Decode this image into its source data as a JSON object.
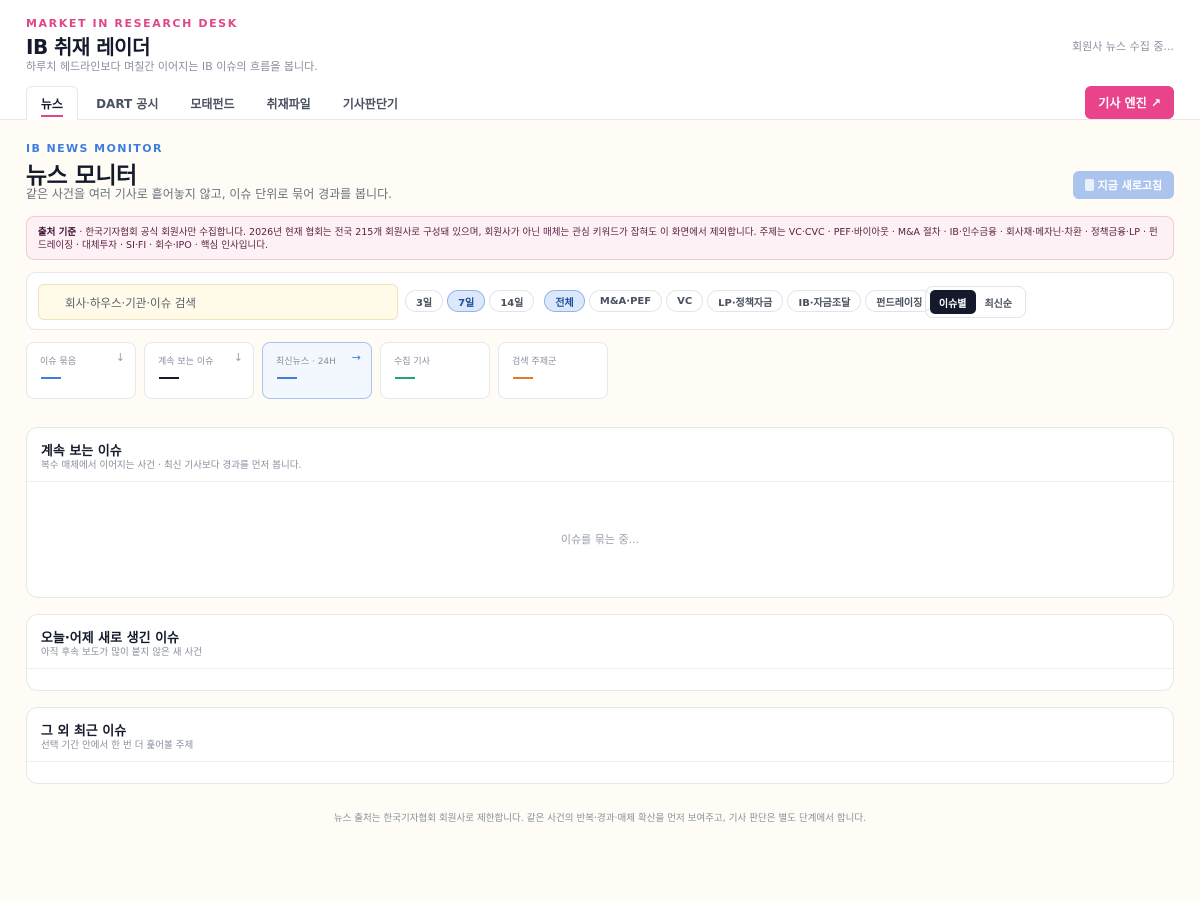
{
  "header": {
    "eyebrow": "MARKET IN RESEARCH DESK",
    "title": "IB 취재 레이더",
    "subtitle": "하루치 헤드라인보다 며칠간 이어지는 IB 이슈의 흐름을 봅니다.",
    "status": "회원사 뉴스 수집 중...",
    "engine_button": "기사 엔진 ↗",
    "tabs": [
      "뉴스",
      "DART 공시",
      "모태펀드",
      "취재파일",
      "기사판단기"
    ]
  },
  "main": {
    "eyebrow": "IB NEWS MONITOR",
    "title": "뉴스 모니터",
    "subtitle": "같은 사건을 여러 기사로 흩어놓지 않고, 이슈 단위로 묶어 경과를 봅니다.",
    "refresh_button": "지금 새로고침"
  },
  "notice": {
    "label": "출처 기준",
    "text": " · 한국기자협회 공식 회원사만 수집합니다. 2026년 현재 협회는 전국 215개 회원사로 구성돼 있으며, 회원사가 아닌 매체는 관심 키워드가 잡혀도 이 화면에서 제외합니다. 주제는 VC·CVC · PEF·바이아웃 · M&A 절차 · IB·인수금융 · 회사채·메자닌·차환 · 정책금융·LP · 펀드레이징 · 대체투자 · SI·FI · 회수·IPO · 핵심 인사입니다."
  },
  "filters": {
    "search_placeholder": "회사·하우스·기관·이슈 검색",
    "periods": [
      "3일",
      "7일",
      "14일"
    ],
    "active_period": "7일",
    "topics": [
      "전체",
      "M&A·PEF",
      "VC",
      "LP·정책자금",
      "IB·자금조달",
      "펀드레이징"
    ],
    "active_topic": "전체",
    "sorts": [
      "이슈별",
      "최신순"
    ],
    "active_sort": "이슈별"
  },
  "stats": [
    {
      "label": "이슈 묶음",
      "arrow": "↓",
      "color": "#3d7ee0"
    },
    {
      "label": "계속 보는 이슈",
      "arrow": "↓",
      "color": "#141a2b"
    },
    {
      "label": "최신뉴스 · 24H",
      "arrow": "→",
      "color": "#3d7ee0"
    },
    {
      "label": "수집 기사",
      "arrow": "",
      "color": "#22a37a"
    },
    {
      "label": "검색 주제군",
      "arrow": "",
      "color": "#e07a2e"
    }
  ],
  "panels": {
    "ongoing": {
      "title": "계속 보는 이슈",
      "subtitle": "복수 매체에서 이어지는 사건 · 최신 기사보다 경과를 먼저 봅니다.",
      "loading": "이슈를 묶는 중..."
    },
    "new": {
      "title": "오늘·어제 새로 생긴 이슈",
      "subtitle": "아직 후속 보도가 많이 붙지 않은 새 사건"
    },
    "other": {
      "title": "그 외 최근 이슈",
      "subtitle": "선택 기간 안에서 한 번 더 훑어볼 주제"
    }
  },
  "footer": "뉴스 출처는 한국기자협회 회원사로 제한합니다. 같은 사건의 반복·경과·매체 확산을 먼저 보여주고, 기사 판단은 별도 단계에서 합니다."
}
